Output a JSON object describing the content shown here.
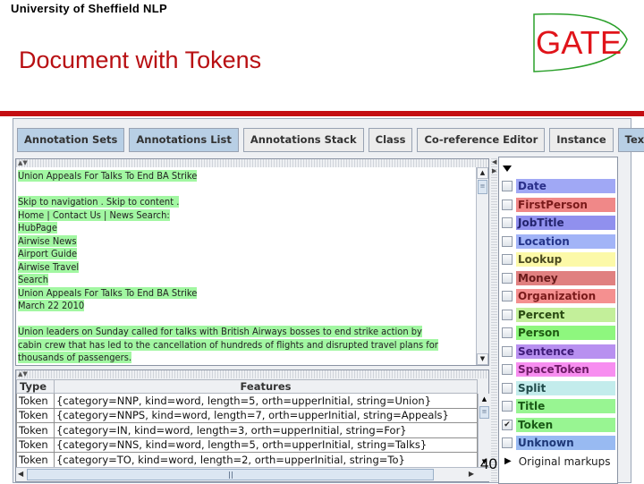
{
  "slide": {
    "organization": "University of Sheffield NLP",
    "title": "Document with Tokens",
    "logo_text": "GATE",
    "page_number": "40",
    "colors": {
      "title": "#b80f12",
      "bar": "#c40d12",
      "logo_red": "#e0141a",
      "logo_green": "#2aa02a"
    }
  },
  "toolbar": {
    "buttons": [
      {
        "label": "Annotation Sets",
        "selected": true
      },
      {
        "label": "Annotations List",
        "selected": true
      },
      {
        "label": "Annotations Stack",
        "selected": false
      },
      {
        "label": "Class",
        "selected": false
      },
      {
        "label": "Co-reference Editor",
        "selected": false
      },
      {
        "label": "Instance",
        "selected": false
      },
      {
        "label": "Text",
        "selected": true
      }
    ],
    "search_icon": "magnifier-icon",
    "dropdown_icon": "triangle-down-icon"
  },
  "document": {
    "highlight_color": "#a2f7a2",
    "lines": [
      "Union Appeals For Talks To End BA Strike",
      "",
      "Skip to navigation . Skip to content .",
      "Home | Contact Us | News Search:",
      "HubPage",
      "Airwise News",
      "Airport Guide",
      "Airwise Travel",
      "Search",
      "Union Appeals For Talks To End BA Strike",
      "March 22  2010",
      "",
      "Union leaders on Sunday called for talks with British Airways bosses to end strike action by",
      "cabin crew that has led to the cancellation of hundreds of flights and disrupted travel plans for",
      "thousands of passengers."
    ]
  },
  "annotations_table": {
    "columns": [
      "Type",
      "Features"
    ],
    "rows": [
      {
        "type": "Token",
        "features": "{category=NNP, kind=word, length=5, orth=upperInitial, string=Union}"
      },
      {
        "type": "Token",
        "features": "{category=NNPS, kind=word, length=7, orth=upperInitial, string=Appeals}"
      },
      {
        "type": "Token",
        "features": "{category=IN, kind=word, length=3, orth=upperInitial, string=For}"
      },
      {
        "type": "Token",
        "features": "{category=NNS, kind=word, length=5, orth=upperInitial, string=Talks}"
      },
      {
        "type": "Token",
        "features": "{category=TO, kind=word, length=2, orth=upperInitial, string=To}"
      }
    ]
  },
  "annotation_sets": {
    "default_set": [
      {
        "label": "Date",
        "checked": false,
        "bg": "#a0a8f5",
        "fg": "#2a2f8a"
      },
      {
        "label": "FirstPerson",
        "checked": false,
        "bg": "#f08888",
        "fg": "#7a1a1a"
      },
      {
        "label": "JobTitle",
        "checked": false,
        "bg": "#9090ee",
        "fg": "#23236e"
      },
      {
        "label": "Location",
        "checked": false,
        "bg": "#a2b4f7",
        "fg": "#24348a"
      },
      {
        "label": "Lookup",
        "checked": false,
        "bg": "#fcf9a8",
        "fg": "#4a4a20"
      },
      {
        "label": "Money",
        "checked": false,
        "bg": "#e08080",
        "fg": "#6a1a1a"
      },
      {
        "label": "Organization",
        "checked": false,
        "bg": "#f59090",
        "fg": "#7a1a1a"
      },
      {
        "label": "Percent",
        "checked": false,
        "bg": "#c3ef9a",
        "fg": "#2a4a12"
      },
      {
        "label": "Person",
        "checked": false,
        "bg": "#8ef77e",
        "fg": "#1f5a12"
      },
      {
        "label": "Sentence",
        "checked": false,
        "bg": "#b890f0",
        "fg": "#3e1a78"
      },
      {
        "label": "SpaceToken",
        "checked": false,
        "bg": "#f78ef0",
        "fg": "#6e1a66"
      },
      {
        "label": "Split",
        "checked": false,
        "bg": "#c3ecec",
        "fg": "#1f4a4a"
      },
      {
        "label": "Title",
        "checked": false,
        "bg": "#98f592",
        "fg": "#1a5a16"
      },
      {
        "label": "Token",
        "checked": true,
        "bg": "#98f592",
        "fg": "#1a5a16"
      },
      {
        "label": "Unknown",
        "checked": false,
        "bg": "#98baf2",
        "fg": "#1e3878"
      }
    ],
    "other_sets": [
      {
        "label": "Original markups",
        "expanded": false
      }
    ]
  }
}
